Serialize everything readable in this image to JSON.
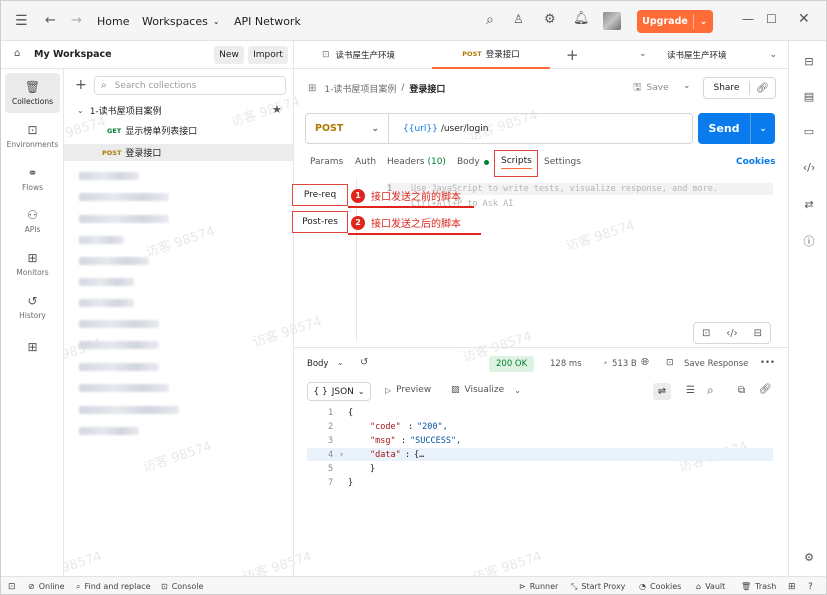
{
  "titlebar": {
    "home": "Home",
    "workspaces": "Workspaces",
    "api_network": "API Network",
    "upgrade": "Upgrade"
  },
  "workspace": {
    "name": "My Workspace",
    "new_btn": "New",
    "import_btn": "Import"
  },
  "rail": [
    {
      "label": "Collections",
      "icon": "trash-collections-icon"
    },
    {
      "label": "Environments",
      "icon": "environment-icon"
    },
    {
      "label": "Flows",
      "icon": "flows-icon"
    },
    {
      "label": "APIs",
      "icon": "apis-icon"
    },
    {
      "label": "Monitors",
      "icon": "monitor-icon"
    },
    {
      "label": "History",
      "icon": "history-icon"
    }
  ],
  "collections": {
    "search_placeholder": "Search collections",
    "root": "1-读书屋项目案例",
    "items": [
      {
        "method": "GET",
        "name": "显示榜单列表接口"
      },
      {
        "method": "POST",
        "name": "登录接口"
      }
    ]
  },
  "tabs": {
    "env_tab": "读书屋生产环境",
    "active_method": "POST",
    "active_name": "登录接口",
    "env_select": "读书屋生产环境"
  },
  "request": {
    "crumb_collection": "1-读书屋项目案例",
    "crumb_sep": "/",
    "crumb_name": "登录接口",
    "save": "Save",
    "share": "Share",
    "method": "POST",
    "url_var": "{{url}}",
    "url_path": "/user/login",
    "send": "Send",
    "subtabs": {
      "params": "Params",
      "auth": "Auth",
      "headers": "Headers",
      "headers_count": "(10)",
      "body": "Body",
      "scripts": "Scripts",
      "settings": "Settings",
      "cookies": "Cookies"
    },
    "script_tabs": {
      "pre": "Pre-req",
      "post": "Post-res"
    },
    "editor_line1": "Use JavaScript to write tests, visualize response, and more.",
    "editor_line2": "Ctrl+Alt+P to Ask AI",
    "annotations": [
      {
        "num": "1",
        "text": "接口发送之前的脚本"
      },
      {
        "num": "2",
        "text": "接口发送之后的脚本"
      }
    ]
  },
  "response": {
    "body_label": "Body",
    "status": "200 OK",
    "time": "128 ms",
    "size": "513 B",
    "save_response": "Save Response",
    "format": "JSON",
    "preview": "Preview",
    "visualize": "Visualize",
    "lines": [
      {
        "n": "1",
        "text": "{"
      },
      {
        "n": "2",
        "key": "\"code\"",
        "val": "\"200\","
      },
      {
        "n": "3",
        "key": "\"msg\"",
        "val": "\"SUCCESS\","
      },
      {
        "n": "4",
        "key": "\"data\"",
        "val": "{…"
      },
      {
        "n": "5",
        "text": "}"
      },
      {
        "n": "7",
        "text": "}"
      }
    ]
  },
  "statusbar": {
    "online": "Online",
    "find_replace": "Find and replace",
    "console": "Console",
    "runner": "Runner",
    "start_proxy": "Start Proxy",
    "cookies": "Cookies",
    "vault": "Vault",
    "trash": "Trash"
  },
  "watermark": "访客 98574",
  "colors": {
    "accent": "#ff6c37",
    "send": "#097bed",
    "annotation": "#e0261c",
    "status_ok": "#007f31"
  }
}
